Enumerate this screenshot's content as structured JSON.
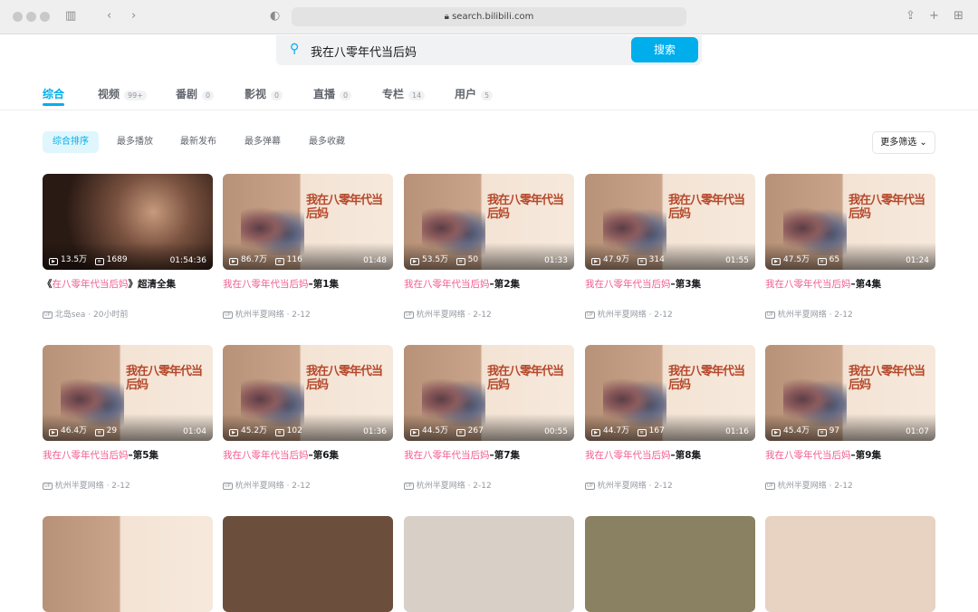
{
  "browser": {
    "url": "search.bilibili.com"
  },
  "search": {
    "query": "我在八零年代当后妈",
    "button": "搜索"
  },
  "tabs": [
    {
      "label": "综合",
      "count": ""
    },
    {
      "label": "视频",
      "count": "99+"
    },
    {
      "label": "番剧",
      "count": "0"
    },
    {
      "label": "影视",
      "count": "0"
    },
    {
      "label": "直播",
      "count": "0"
    },
    {
      "label": "专栏",
      "count": "14"
    },
    {
      "label": "用户",
      "count": "5"
    }
  ],
  "sort": [
    "综合排序",
    "最多播放",
    "最新发布",
    "最多弹幕",
    "最多收藏"
  ],
  "more_filters": "更多筛选",
  "poster_text": "我在八零年代当后妈",
  "accent": "#00aeec",
  "highlight": "#f25d8e",
  "videos": [
    {
      "pre": "《",
      "hl": "在八零年代当后妈",
      "post": "》超清全集",
      "views": "13.5万",
      "danmaku": "1689",
      "duration": "01:54:36",
      "author": "北岛sea",
      "date": "20小时前",
      "dark": true
    },
    {
      "pre": "",
      "hl": "我在八零年代当后妈",
      "post": "–第1集",
      "views": "86.7万",
      "danmaku": "116",
      "duration": "01:48",
      "author": "杭州半夏网络",
      "date": "2-12"
    },
    {
      "pre": "",
      "hl": "我在八零年代当后妈",
      "post": "–第2集",
      "views": "53.5万",
      "danmaku": "50",
      "duration": "01:33",
      "author": "杭州半夏网络",
      "date": "2-12"
    },
    {
      "pre": "",
      "hl": "我在八零年代当后妈",
      "post": "–第3集",
      "views": "47.9万",
      "danmaku": "314",
      "duration": "01:55",
      "author": "杭州半夏网络",
      "date": "2-12"
    },
    {
      "pre": "",
      "hl": "我在八零年代当后妈",
      "post": "–第4集",
      "views": "47.5万",
      "danmaku": "65",
      "duration": "01:24",
      "author": "杭州半夏网络",
      "date": "2-12"
    },
    {
      "pre": "",
      "hl": "我在八零年代当后妈",
      "post": "–第5集",
      "views": "46.4万",
      "danmaku": "29",
      "duration": "01:04",
      "author": "杭州半夏网络",
      "date": "2-12"
    },
    {
      "pre": "",
      "hl": "我在八零年代当后妈",
      "post": "–第6集",
      "views": "45.2万",
      "danmaku": "102",
      "duration": "01:36",
      "author": "杭州半夏网络",
      "date": "2-12"
    },
    {
      "pre": "",
      "hl": "我在八零年代当后妈",
      "post": "–第7集",
      "views": "44.5万",
      "danmaku": "267",
      "duration": "00:55",
      "author": "杭州半夏网络",
      "date": "2-12"
    },
    {
      "pre": "",
      "hl": "我在八零年代当后妈",
      "post": "–第8集",
      "views": "44.7万",
      "danmaku": "167",
      "duration": "01:16",
      "author": "杭州半夏网络",
      "date": "2-12"
    },
    {
      "pre": "",
      "hl": "我在八零年代当后妈",
      "post": "–第9集",
      "views": "45.4万",
      "danmaku": "97",
      "duration": "01:07",
      "author": "杭州半夏网络",
      "date": "2-12"
    }
  ]
}
